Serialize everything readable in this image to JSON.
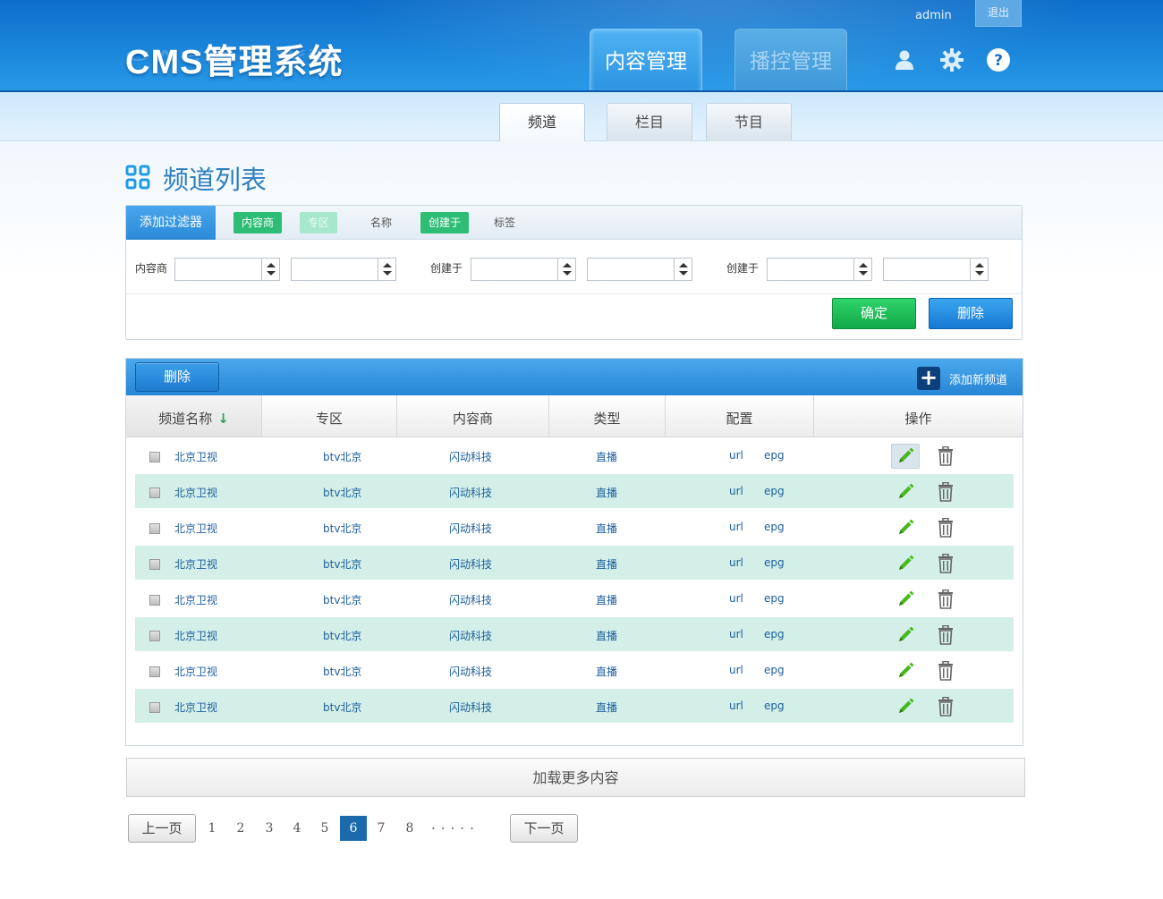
{
  "header": {
    "logo": "CMS管理系统",
    "username": "admin",
    "logout_label": "退出",
    "main_tabs": [
      {
        "label": "内容管理",
        "active": true
      },
      {
        "label": "播控管理",
        "active": false
      }
    ],
    "icons": [
      "user-icon",
      "gear-icon",
      "help-icon"
    ]
  },
  "subnav": {
    "tabs": [
      {
        "label": "频道",
        "active": true
      },
      {
        "label": "栏目",
        "active": false
      },
      {
        "label": "节目",
        "active": false
      }
    ]
  },
  "page": {
    "title": "频道列表",
    "title_icon": "grid-icon"
  },
  "filter": {
    "add_filter_label": "添加过滤器",
    "chips": [
      {
        "label": "内容商",
        "state": "on"
      },
      {
        "label": "专区",
        "state": "soft"
      },
      {
        "label": "名称",
        "state": "plain"
      },
      {
        "label": "创建于",
        "state": "on"
      },
      {
        "label": "标签",
        "state": "plain"
      }
    ],
    "fields": [
      {
        "label": "内容商"
      },
      {
        "label": "创建于"
      },
      {
        "label": "创建于"
      }
    ],
    "confirm_label": "确定",
    "delete_label": "删除"
  },
  "table": {
    "delete_label": "删除",
    "add_label": "添加新频道",
    "columns": [
      "频道名称",
      "专区",
      "内容商",
      "类型",
      "配置",
      "操作"
    ],
    "sorted_column": "频道名称",
    "rows": [
      {
        "name": "北京卫视",
        "zone": "btv北京",
        "provider": "闪动科技",
        "type": "直播",
        "cfg1": "url",
        "cfg2": "epg"
      },
      {
        "name": "北京卫视",
        "zone": "btv北京",
        "provider": "闪动科技",
        "type": "直播",
        "cfg1": "url",
        "cfg2": "epg"
      },
      {
        "name": "北京卫视",
        "zone": "btv北京",
        "provider": "闪动科技",
        "type": "直播",
        "cfg1": "url",
        "cfg2": "epg"
      },
      {
        "name": "北京卫视",
        "zone": "btv北京",
        "provider": "闪动科技",
        "type": "直播",
        "cfg1": "url",
        "cfg2": "epg"
      },
      {
        "name": "北京卫视",
        "zone": "btv北京",
        "provider": "闪动科技",
        "type": "直播",
        "cfg1": "url",
        "cfg2": "epg"
      },
      {
        "name": "北京卫视",
        "zone": "btv北京",
        "provider": "闪动科技",
        "type": "直播",
        "cfg1": "url",
        "cfg2": "epg"
      },
      {
        "name": "北京卫视",
        "zone": "btv北京",
        "provider": "闪动科技",
        "type": "直播",
        "cfg1": "url",
        "cfg2": "epg"
      },
      {
        "name": "北京卫视",
        "zone": "btv北京",
        "provider": "闪动科技",
        "type": "直播",
        "cfg1": "url",
        "cfg2": "epg"
      }
    ]
  },
  "load_more_label": "加载更多内容",
  "pagination": {
    "prev_label": "上一页",
    "next_label": "下一页",
    "pages": [
      "1",
      "2",
      "3",
      "4",
      "5",
      "6",
      "7",
      "8"
    ],
    "current": "6",
    "ellipsis": "....."
  },
  "colors": {
    "header_blue": "#1a86db",
    "accent_green": "#2dbd74",
    "row_alt": "#d3efe7",
    "link_blue": "#1d5f9e",
    "current_page": "#1a6aac"
  }
}
